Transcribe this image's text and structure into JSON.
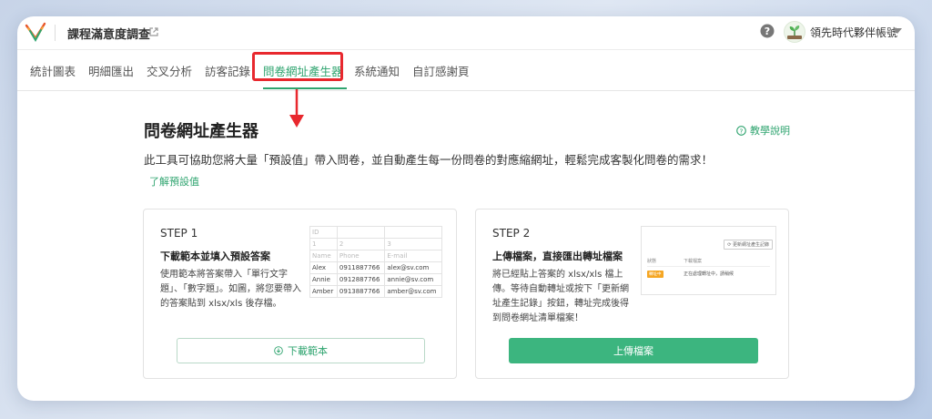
{
  "header": {
    "survey_title": "課程滿意度調查",
    "account_name": "領先時代夥伴帳號"
  },
  "tabs": [
    {
      "label": "統計圖表"
    },
    {
      "label": "明細匯出"
    },
    {
      "label": "交叉分析"
    },
    {
      "label": "訪客記錄"
    },
    {
      "label": "問卷網址產生器",
      "active": true
    },
    {
      "label": "系統通知"
    },
    {
      "label": "自訂感謝頁"
    }
  ],
  "main": {
    "page_title": "問卷網址產生器",
    "help_link": "教學說明",
    "description": "此工具可協助您將大量「預設值」帶入問卷，並自動產生每一份問卷的對應縮網址，輕鬆完成客製化問卷的需求！",
    "learn_link": "了解預設值"
  },
  "step1": {
    "label": "STEP 1",
    "title": "下載範本並填入預設答案",
    "description": "使用範本將答案帶入「單行文字題」、「數字題」。如圖，將您要帶入的答案貼到 xlsx/xls 後存檔。",
    "button": "下載範本",
    "table": {
      "rows": [
        [
          "ID",
          "",
          ""
        ],
        [
          "1",
          "2",
          "3"
        ],
        [
          "Name",
          "Phone",
          "E-mail"
        ],
        [
          "Alex",
          "0911887766",
          "alex@sv.com"
        ],
        [
          "Annie",
          "0912887766",
          "annie@sv.com"
        ],
        [
          "Amber",
          "0913887766",
          "amber@sv.com"
        ]
      ]
    }
  },
  "step2": {
    "label": "STEP 2",
    "title": "上傳檔案，直接匯出轉址檔案",
    "description": "將已經貼上答案的 xlsx/xls 檔上傳。等待自動轉址或按下「更新網址產生記錄」按鈕，轉址完成後得到問卷網址清單檔案！",
    "button": "上傳檔案",
    "preview": {
      "refresh_button": "⟳ 更新網址產生記錄",
      "col_status": "狀態",
      "col_download": "下載檔案",
      "badge": "轉址中",
      "row_text": "正在處理轉址中，請稍候"
    }
  },
  "colors": {
    "accent": "#2fa46f",
    "button": "#3cb57f",
    "highlight": "#e8282e"
  }
}
